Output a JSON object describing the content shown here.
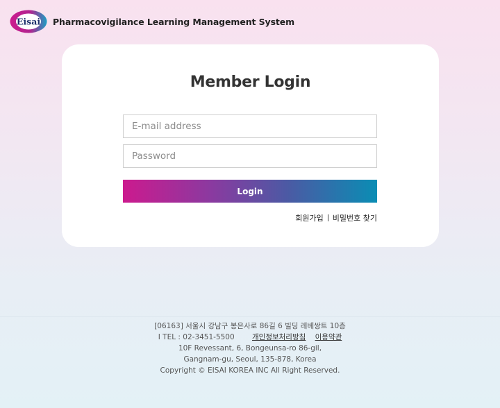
{
  "header": {
    "logo_text": "Eisai",
    "app_title": "Pharmacovigilance Learning Management System"
  },
  "login": {
    "title": "Member Login",
    "email_placeholder": "E-mail address",
    "password_placeholder": "Password",
    "login_label": "Login",
    "signup_label": "회원가입",
    "find_password_label": "비밀번호 찾기"
  },
  "footer": {
    "address_kr": "[06163] 서울시 강남구 봉은사로 86길 6 빌딩 레베쌍트 10층",
    "tel": "I TEL : 02-3451-5500",
    "privacy_label": "개인정보처리방침",
    "terms_label": "이용약관",
    "address_en_1": "10F Revessant, 6, Bongeunsa-ro 86-gil,",
    "address_en_2": "Gangnam-gu, Seoul, 135-878, Korea",
    "copyright": "Copyright © EISAI KOREA INC All Right Reserved."
  },
  "colors": {
    "brand_magenta": "#cc1a8e",
    "brand_teal": "#0a8db4",
    "logo_navy": "#1b2f6b"
  }
}
